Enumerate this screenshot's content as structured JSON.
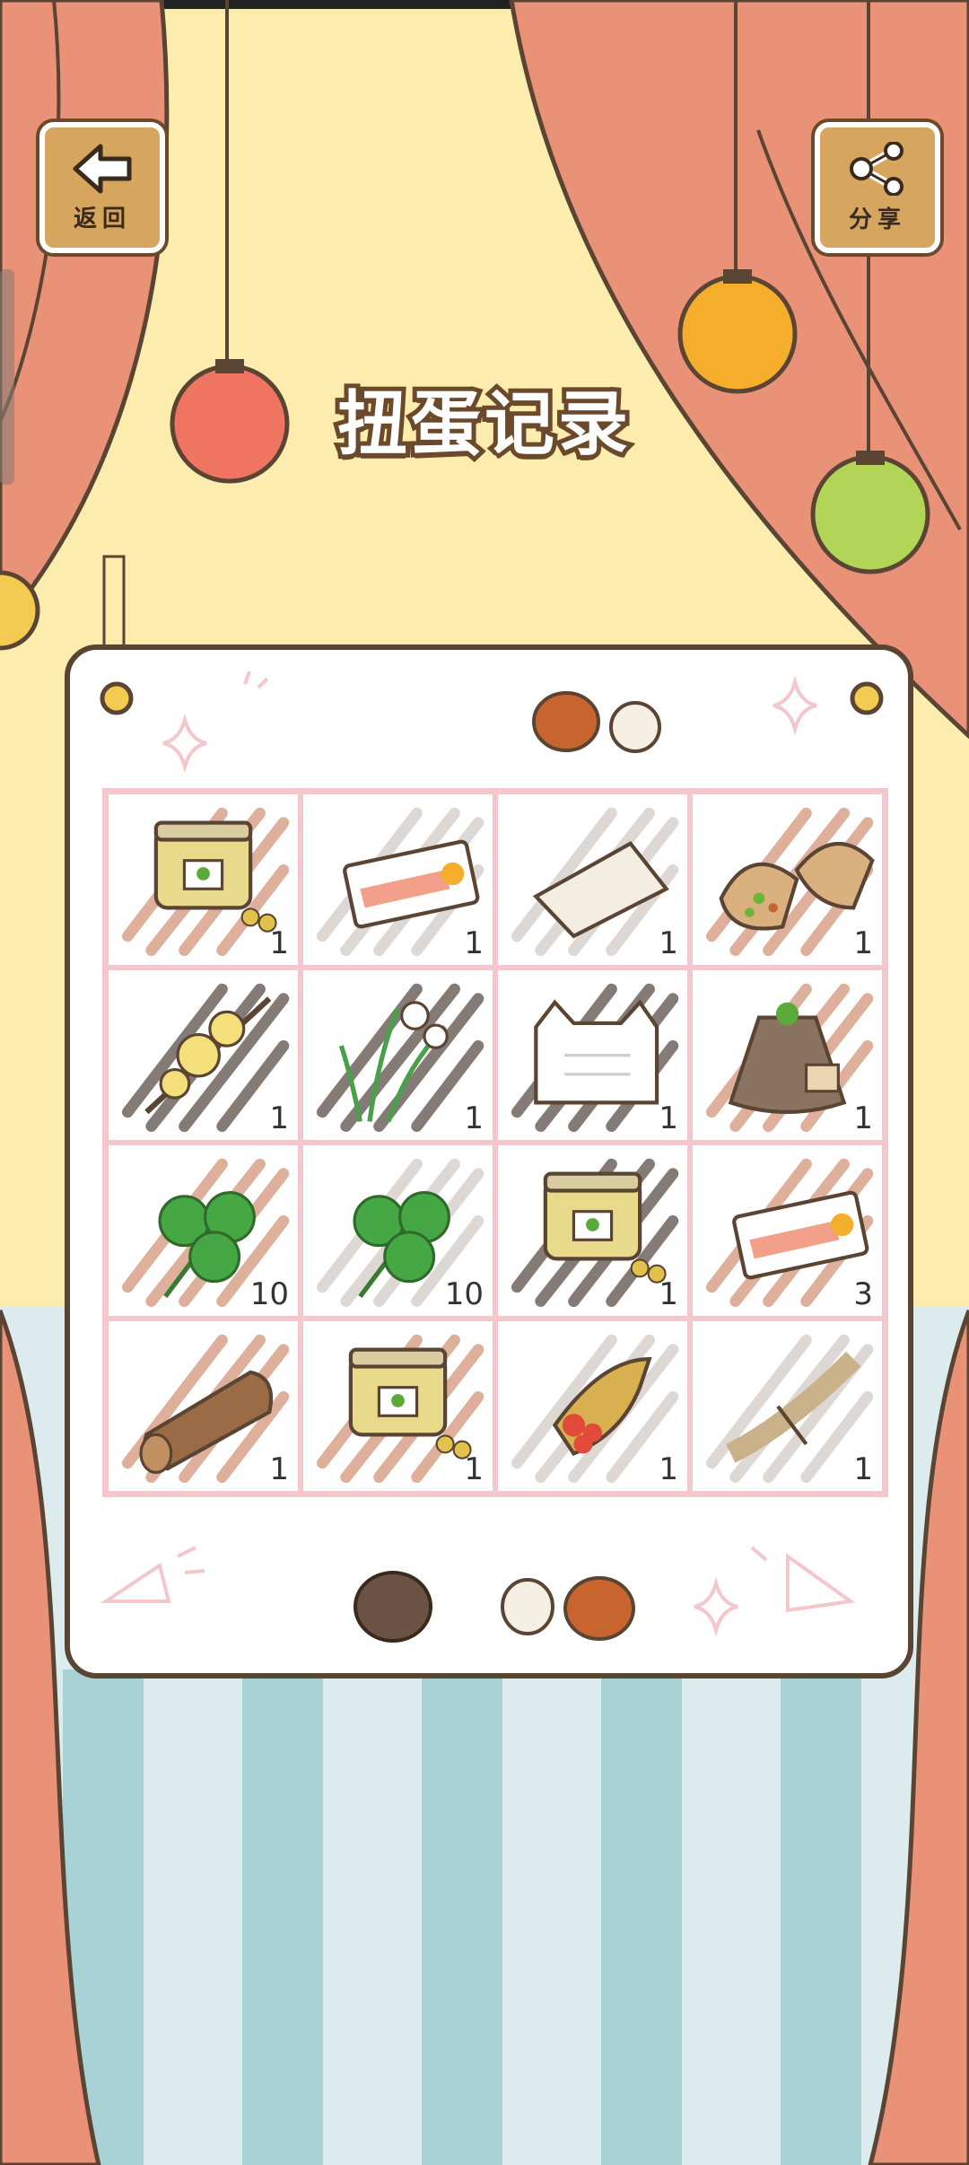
{
  "header": {
    "back_label": "返回",
    "share_label": "分享",
    "title": "扭蛋记录"
  },
  "colors": {
    "curtain": "#ea9278",
    "backdrop": "#fcecae",
    "floor_light": "#dcecee",
    "floor_stripe": "#a9d2d7",
    "board_border": "#5a4433",
    "grid_pink": "#f3c7cc"
  },
  "items": [
    {
      "name": "grain-jar",
      "rarity": "brown",
      "count": "1"
    },
    {
      "name": "ticket",
      "rarity": "gray",
      "count": "1"
    },
    {
      "name": "paper-sheet",
      "rarity": "gray",
      "count": "1"
    },
    {
      "name": "pita-sandwich",
      "rarity": "brown",
      "count": "1"
    },
    {
      "name": "plum-blossom",
      "rarity": "dark",
      "count": "1"
    },
    {
      "name": "white-flower",
      "rarity": "dark",
      "count": "1"
    },
    {
      "name": "cat-note",
      "rarity": "dark",
      "count": "1"
    },
    {
      "name": "seed-bag",
      "rarity": "brown",
      "count": "1"
    },
    {
      "name": "clover",
      "rarity": "brown",
      "count": "10"
    },
    {
      "name": "clover",
      "rarity": "gray",
      "count": "10"
    },
    {
      "name": "grain-jar",
      "rarity": "dark",
      "count": "1"
    },
    {
      "name": "ticket",
      "rarity": "brown",
      "count": "3"
    },
    {
      "name": "log",
      "rarity": "brown",
      "count": "1"
    },
    {
      "name": "grain-jar",
      "rarity": "brown",
      "count": "1"
    },
    {
      "name": "cornucopia",
      "rarity": "gray",
      "count": "1"
    },
    {
      "name": "rope-bundle",
      "rarity": "gray",
      "count": "1"
    }
  ]
}
